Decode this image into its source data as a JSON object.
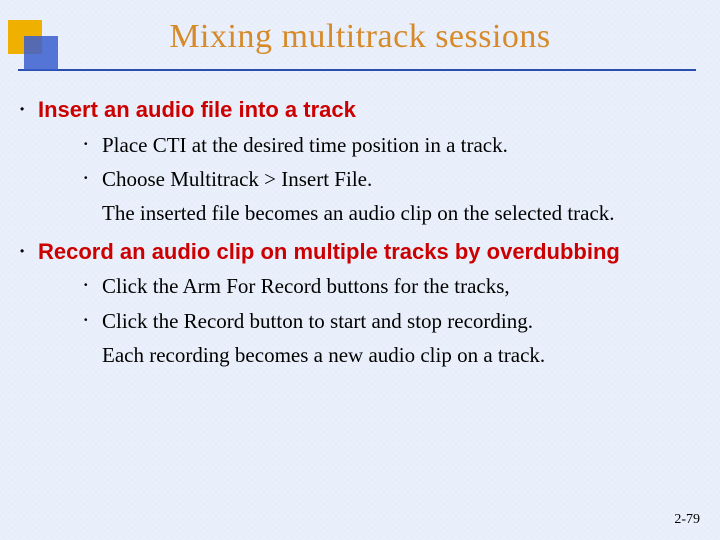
{
  "title": "Mixing multitrack sessions",
  "sections": [
    {
      "heading": "Insert an audio file into a track",
      "items": [
        {
          "text": "Place CTI at the desired time position in a track.",
          "bulleted": true
        },
        {
          "text": "Choose Multitrack > Insert File.",
          "bulleted": true
        },
        {
          "text": "The inserted file becomes an audio clip on the selected track.",
          "bulleted": false
        }
      ]
    },
    {
      "heading": "Record an audio clip on multiple tracks by overdubbing",
      "items": [
        {
          "text": "Click the Arm For Record buttons for the tracks,",
          "bulleted": true
        },
        {
          "text": "Click the Record button to start and stop recording.",
          "bulleted": true
        },
        {
          "text": "Each recording becomes a new audio clip on a track.",
          "bulleted": false
        }
      ]
    }
  ],
  "page_number": "2-79"
}
